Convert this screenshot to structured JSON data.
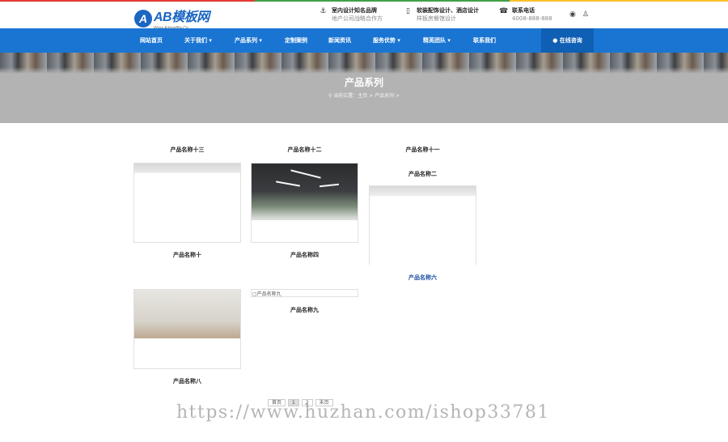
{
  "header": {
    "logo_main": "AB模板网",
    "logo_sub": "Www.Admin8by.Cn",
    "logo_badge": "A",
    "info": [
      {
        "icon": "anchor-icon",
        "title": "室内设计知名品牌",
        "sub": "地产公司战略合作方"
      },
      {
        "icon": "phone-device-icon",
        "title": "软装配饰设计、酒店设计",
        "sub": "样板房餐馆设计"
      },
      {
        "icon": "phone-icon",
        "title": "联系电话",
        "sub": "4008-888-888"
      }
    ],
    "social": [
      "weibo-icon",
      "qq-icon"
    ]
  },
  "nav": {
    "items": [
      {
        "label": "网站首页"
      },
      {
        "label": "关于我们 ▾"
      },
      {
        "label": "产品系列 ▾"
      },
      {
        "label": "定制案例"
      },
      {
        "label": "新闻资讯"
      },
      {
        "label": "服务优势 ▾"
      },
      {
        "label": "精英团队 ▾"
      },
      {
        "label": "联系我们"
      }
    ],
    "consult_label": "在线咨询",
    "consult_icon": "chat-bubble-icon"
  },
  "banner": {
    "title": "产品系列",
    "breadcrumb_prefix": "当前位置：",
    "breadcrumb": "主页 > 产品系列 >"
  },
  "products": {
    "top_names": [
      "产品名称十三",
      "产品名称十二",
      "产品名称十一"
    ],
    "col3_second_name": "产品名称二",
    "row1_bottom_names": [
      "产品名称十",
      "产品名称四"
    ],
    "col3_bottom_name": "产品名称六",
    "broken_alt": "产品名称九",
    "row2_names": [
      "产品名称八",
      "产品名称九"
    ]
  },
  "pagination": {
    "first": "首页",
    "pages": [
      "1",
      "2"
    ],
    "current": "1",
    "last": "末页"
  },
  "watermark": "https://www.huzhan.com/ishop33781",
  "colors": {
    "nav_bg": "#1a75d2",
    "consult_bg": "#0f5fb4",
    "banner_bg": "#b3b3b3",
    "link": "#1a4fa0"
  }
}
